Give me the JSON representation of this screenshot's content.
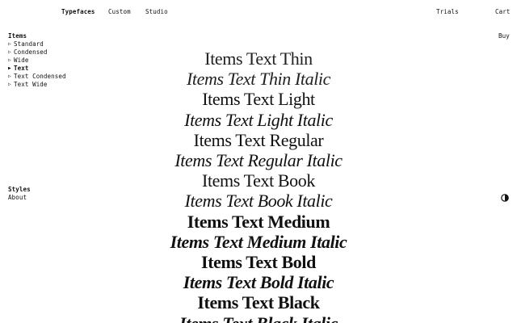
{
  "nav": {
    "typefaces": "Typefaces",
    "custom": "Custom",
    "studio": "Studio",
    "trials": "Trials",
    "cart": "Cart",
    "buy": "Buy"
  },
  "sidebar": {
    "heading": "Items",
    "items": [
      {
        "label": "Standard",
        "marker": "▷",
        "active": false
      },
      {
        "label": "Condensed",
        "marker": "▷",
        "active": false
      },
      {
        "label": "Wide",
        "marker": "▷",
        "active": false
      },
      {
        "label": "Text",
        "marker": "▶",
        "active": true
      },
      {
        "label": "Text Condensed",
        "marker": "▷",
        "active": false
      },
      {
        "label": "Text Wide",
        "marker": "▷",
        "active": false
      }
    ]
  },
  "styles": {
    "heading": "Styles",
    "about": "About"
  },
  "contrast_toggle": {
    "icon": "half-circle-contrast-icon"
  },
  "specimen": {
    "lines": [
      "Items Text Thin",
      "Items Text Thin Italic",
      "Items Text Light",
      "Items Text Light Italic",
      "Items Text Regular",
      "Items Text Regular Italic",
      "Items Text Book",
      "Items Text Book Italic",
      "Items Text Medium",
      "Items Text Medium Italic",
      "Items Text Bold",
      "Items Text Bold Italic",
      "Items Text Black",
      "Items Text Black Italic"
    ]
  }
}
